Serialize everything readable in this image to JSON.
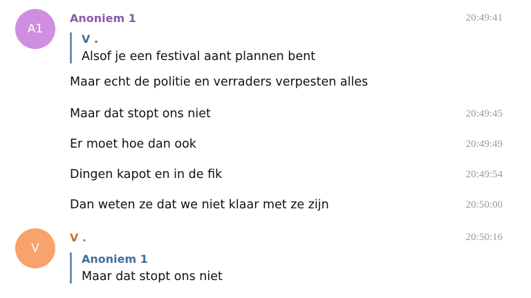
{
  "colors": {
    "avatar_a1": "#cf8ee0",
    "avatar_v": "#f8a26c",
    "name_a1": "#8a5aa8",
    "name_v": "#b8763e",
    "reply_name": "#3f6f9a",
    "reply_bar": "#6c8fbf",
    "time": "#9a9a9a"
  },
  "groups": [
    {
      "avatar_initials": "A1",
      "sender": "Anoniem 1",
      "time": "20:49:41",
      "reply": {
        "author": "V .",
        "text": "Alsof je een festival aant plannen bent"
      },
      "first_text": "Maar echt de politie en verraders verpesten alles"
    },
    {
      "avatar_initials": "V",
      "sender": "V .",
      "time": "20:50:16",
      "reply": {
        "author": "Anoniem 1",
        "text": "Maar dat stopt ons niet"
      }
    }
  ],
  "messages": [
    {
      "text": "Maar dat stopt ons niet",
      "time": "20:49:45"
    },
    {
      "text": "Er moet hoe dan ook",
      "time": "20:49:49"
    },
    {
      "text": "Dingen kapot en in de fik",
      "time": "20:49:54"
    },
    {
      "text": "Dan weten ze dat we niet klaar met ze zijn",
      "time": "20:50:00"
    }
  ]
}
